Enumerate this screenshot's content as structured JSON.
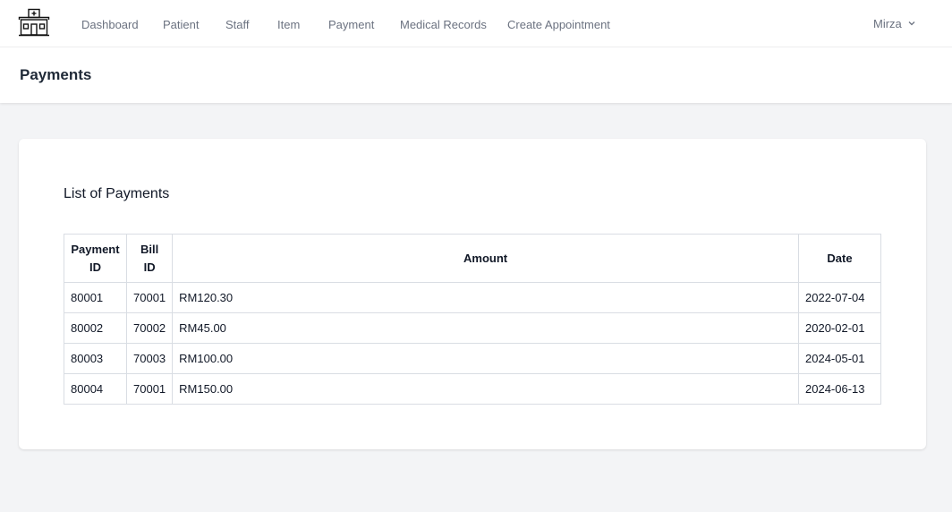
{
  "nav": {
    "items": [
      {
        "label": "Dashboard"
      },
      {
        "label": "Patient"
      },
      {
        "label": "Staff"
      },
      {
        "label": "Item"
      },
      {
        "label": "Payment"
      },
      {
        "label": "Medical Records"
      },
      {
        "label": "Create Appointment"
      }
    ],
    "user": "Mirza",
    "logo_icon": "hospital-icon",
    "dropdown_icon": "chevron-down-icon"
  },
  "header": {
    "title": "Payments"
  },
  "card": {
    "title": "List of Payments"
  },
  "table": {
    "headers": {
      "payment_id": [
        "Payment",
        "ID"
      ],
      "bill_id": [
        "Bill",
        "ID"
      ],
      "amount": "Amount",
      "date": "Date"
    },
    "rows": [
      {
        "payment_id": "80001",
        "bill_id": "70001",
        "amount": "RM120.30",
        "date": "2022-07-04"
      },
      {
        "payment_id": "80002",
        "bill_id": "70002",
        "amount": "RM45.00",
        "date": "2020-02-01"
      },
      {
        "payment_id": "80003",
        "bill_id": "70003",
        "amount": "RM100.00",
        "date": "2024-05-01"
      },
      {
        "payment_id": "80004",
        "bill_id": "70001",
        "amount": "RM150.00",
        "date": "2024-06-13"
      }
    ]
  },
  "colors": {
    "page_bg": "#f3f4f6",
    "nav_text": "#6b7280",
    "border": "#d9dde3"
  }
}
